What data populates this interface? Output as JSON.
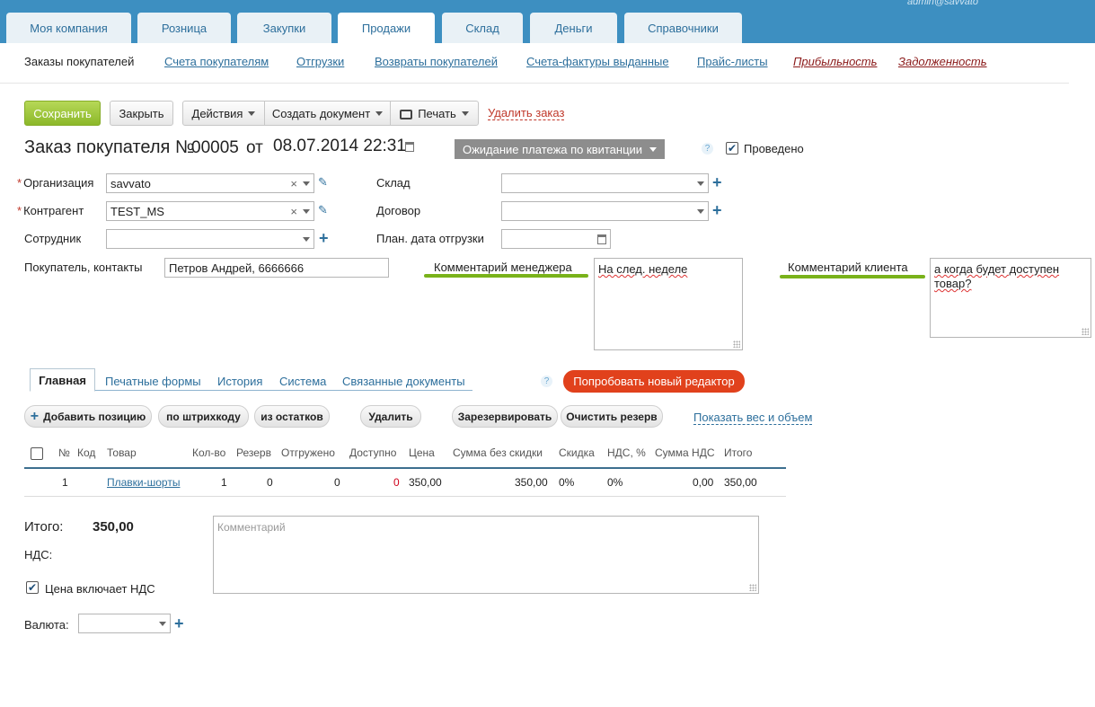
{
  "user": "admin@savvato",
  "nav": {
    "tabs": [
      "Моя компания",
      "Розница",
      "Закупки",
      "Продажи",
      "Склад",
      "Деньги",
      "Справочники"
    ],
    "active_index": 3
  },
  "subnav": {
    "current": "Заказы покупателей",
    "links": [
      "Счета покупателям",
      "Отгрузки",
      "Возвраты покупателей",
      "Счета-фактуры выданные",
      "Прайс-листы"
    ],
    "reports": [
      "Прибыльность",
      "Задолженность"
    ]
  },
  "toolbar": {
    "save": "Сохранить",
    "close": "Закрыть",
    "actions": "Действия",
    "create_doc": "Создать документ",
    "print": "Печать",
    "delete": "Удалить заказ"
  },
  "order": {
    "title": "Заказ покупателя №",
    "number": "00005",
    "from": "от",
    "date": "08.07.2014 22:31",
    "status": "Ожидание платежа по квитанции",
    "help": "?",
    "posted_label": "Проведено",
    "posted": true
  },
  "form": {
    "organization_label": "Организация",
    "organization_value": "savvato",
    "counterparty_label": "Контрагент",
    "counterparty_value": "TEST_MS",
    "employee_label": "Сотрудник",
    "employee_value": "",
    "buyer_contacts_label": "Покупатель, контакты",
    "buyer_contacts_value": "Петров Андрей,  6666666",
    "warehouse_label": "Склад",
    "contract_label": "Договор",
    "ship_date_label": "План. дата отгрузки",
    "manager_comment_label": "Комментарий менеджера",
    "manager_comment": "На след. неделе",
    "client_comment_label": "Комментарий клиента",
    "client_comment_line1": "а когда будет доступен",
    "client_comment_line2": "товар?"
  },
  "panel_tabs": {
    "main": "Главная",
    "print_forms": "Печатные формы",
    "history": "История",
    "system": "Система",
    "related": "Связанные документы",
    "try_editor": "Попробовать новый редактор"
  },
  "positions_toolbar": {
    "add": "Добавить позицию",
    "barcode": "по штрихкоду",
    "from_stock": "из остатков",
    "delete": "Удалить",
    "reserve": "Зарезервировать",
    "clear_reserve": "Очистить резерв",
    "show_weight": "Показать вес и объем"
  },
  "table": {
    "columns": [
      "№",
      "Код",
      "Товар",
      "Кол-во",
      "Резерв",
      "Отгружено",
      "Доступно",
      "Цена",
      "Сумма без скидки",
      "Скидка",
      "НДС, %",
      "Сумма НДС",
      "Итого"
    ],
    "rows": [
      [
        "1",
        "",
        "Плавки-шорты",
        "1",
        "0",
        "0",
        "0",
        "350,00",
        "350,00",
        "0%",
        "0%",
        "0,00",
        "350,00"
      ]
    ]
  },
  "footer": {
    "total_label": "Итого:",
    "total_value": "350,00",
    "vat_label": "НДС:",
    "comment_placeholder": "Комментарий",
    "price_includes_vat_label": "Цена включает НДС",
    "price_includes_vat": true,
    "currency_label": "Валюта:",
    "currency_value": ""
  },
  "colors": {
    "topbar": "#3d8fc1",
    "save_button": "#9cc63a",
    "status_button": "#8d8d8d",
    "try_editor": "#e1411c",
    "comment_underline": "#79b21a",
    "link": "#2d6f9c"
  }
}
